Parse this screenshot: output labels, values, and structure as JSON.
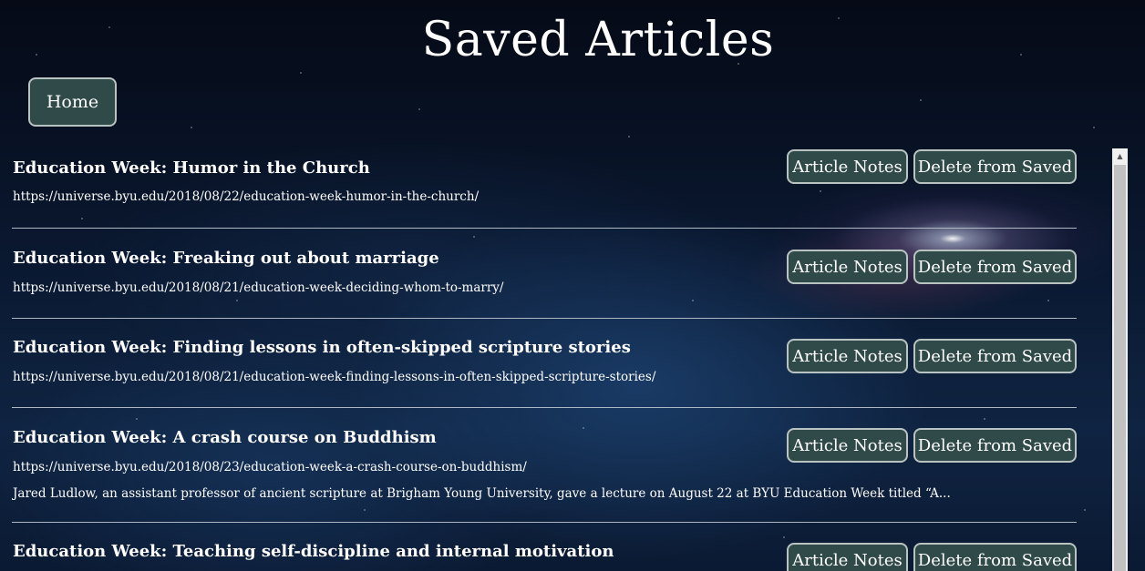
{
  "page": {
    "title": "Saved Articles",
    "home_label": "Home"
  },
  "buttons": {
    "notes_label": "Article Notes",
    "delete_label": "Delete from Saved"
  },
  "articles": [
    {
      "title": "Education Week: Humor in the Church",
      "url": "https://universe.byu.edu/2018/08/22/education-week-humor-in-the-church/",
      "summary": ""
    },
    {
      "title": "Education Week: Freaking out about marriage",
      "url": "https://universe.byu.edu/2018/08/21/education-week-deciding-whom-to-marry/",
      "summary": ""
    },
    {
      "title": "Education Week: Finding lessons in often-skipped scripture stories",
      "url": "https://universe.byu.edu/2018/08/21/education-week-finding-lessons-in-often-skipped-scripture-stories/",
      "summary": ""
    },
    {
      "title": "Education Week: A crash course on Buddhism",
      "url": "https://universe.byu.edu/2018/08/23/education-week-a-crash-course-on-buddhism/",
      "summary": "Jared Ludlow, an assistant professor of ancient scripture at Brigham Young University, gave a lecture on August 22 at BYU Education Week titled “A..."
    },
    {
      "title": "Education Week: Teaching self-discipline and internal motivation",
      "url": "",
      "summary": ""
    }
  ],
  "colors": {
    "button_bg": "#2f4a48",
    "button_border": "#b9c3c2",
    "divider": "#aeb8c4"
  },
  "icons": {
    "scroll_up": "scroll-up-arrow-icon"
  }
}
